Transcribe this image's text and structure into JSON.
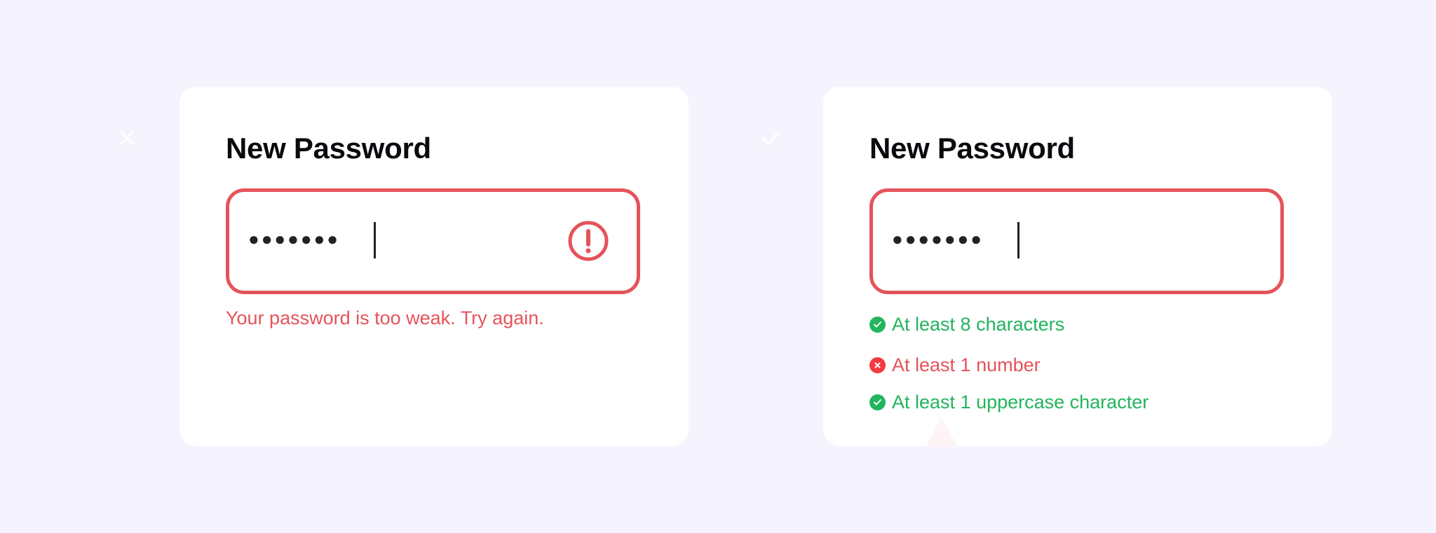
{
  "colors": {
    "background": "#f5f4fe",
    "card": "#ffffff",
    "error": "#e5535a",
    "badge_bad": "#f23b3f",
    "success": "#22b45e",
    "text": "#0b0b0f"
  },
  "bad_example": {
    "badge_icon": "close-icon",
    "title": "New Password",
    "password_mask": "●●●●●●●",
    "status_icon": "exclamation-icon",
    "error_message": "Your password is too weak. Try again."
  },
  "good_example": {
    "badge_icon": "check-icon",
    "title": "New Password",
    "password_mask": "●●●●●●●",
    "requirements": [
      {
        "label": "At least 8 characters",
        "met": true,
        "icon": "check-icon"
      },
      {
        "label": "At least 1 number",
        "met": false,
        "icon": "close-icon"
      },
      {
        "label": "At least 1 uppercase character",
        "met": true,
        "icon": "check-icon"
      }
    ]
  }
}
